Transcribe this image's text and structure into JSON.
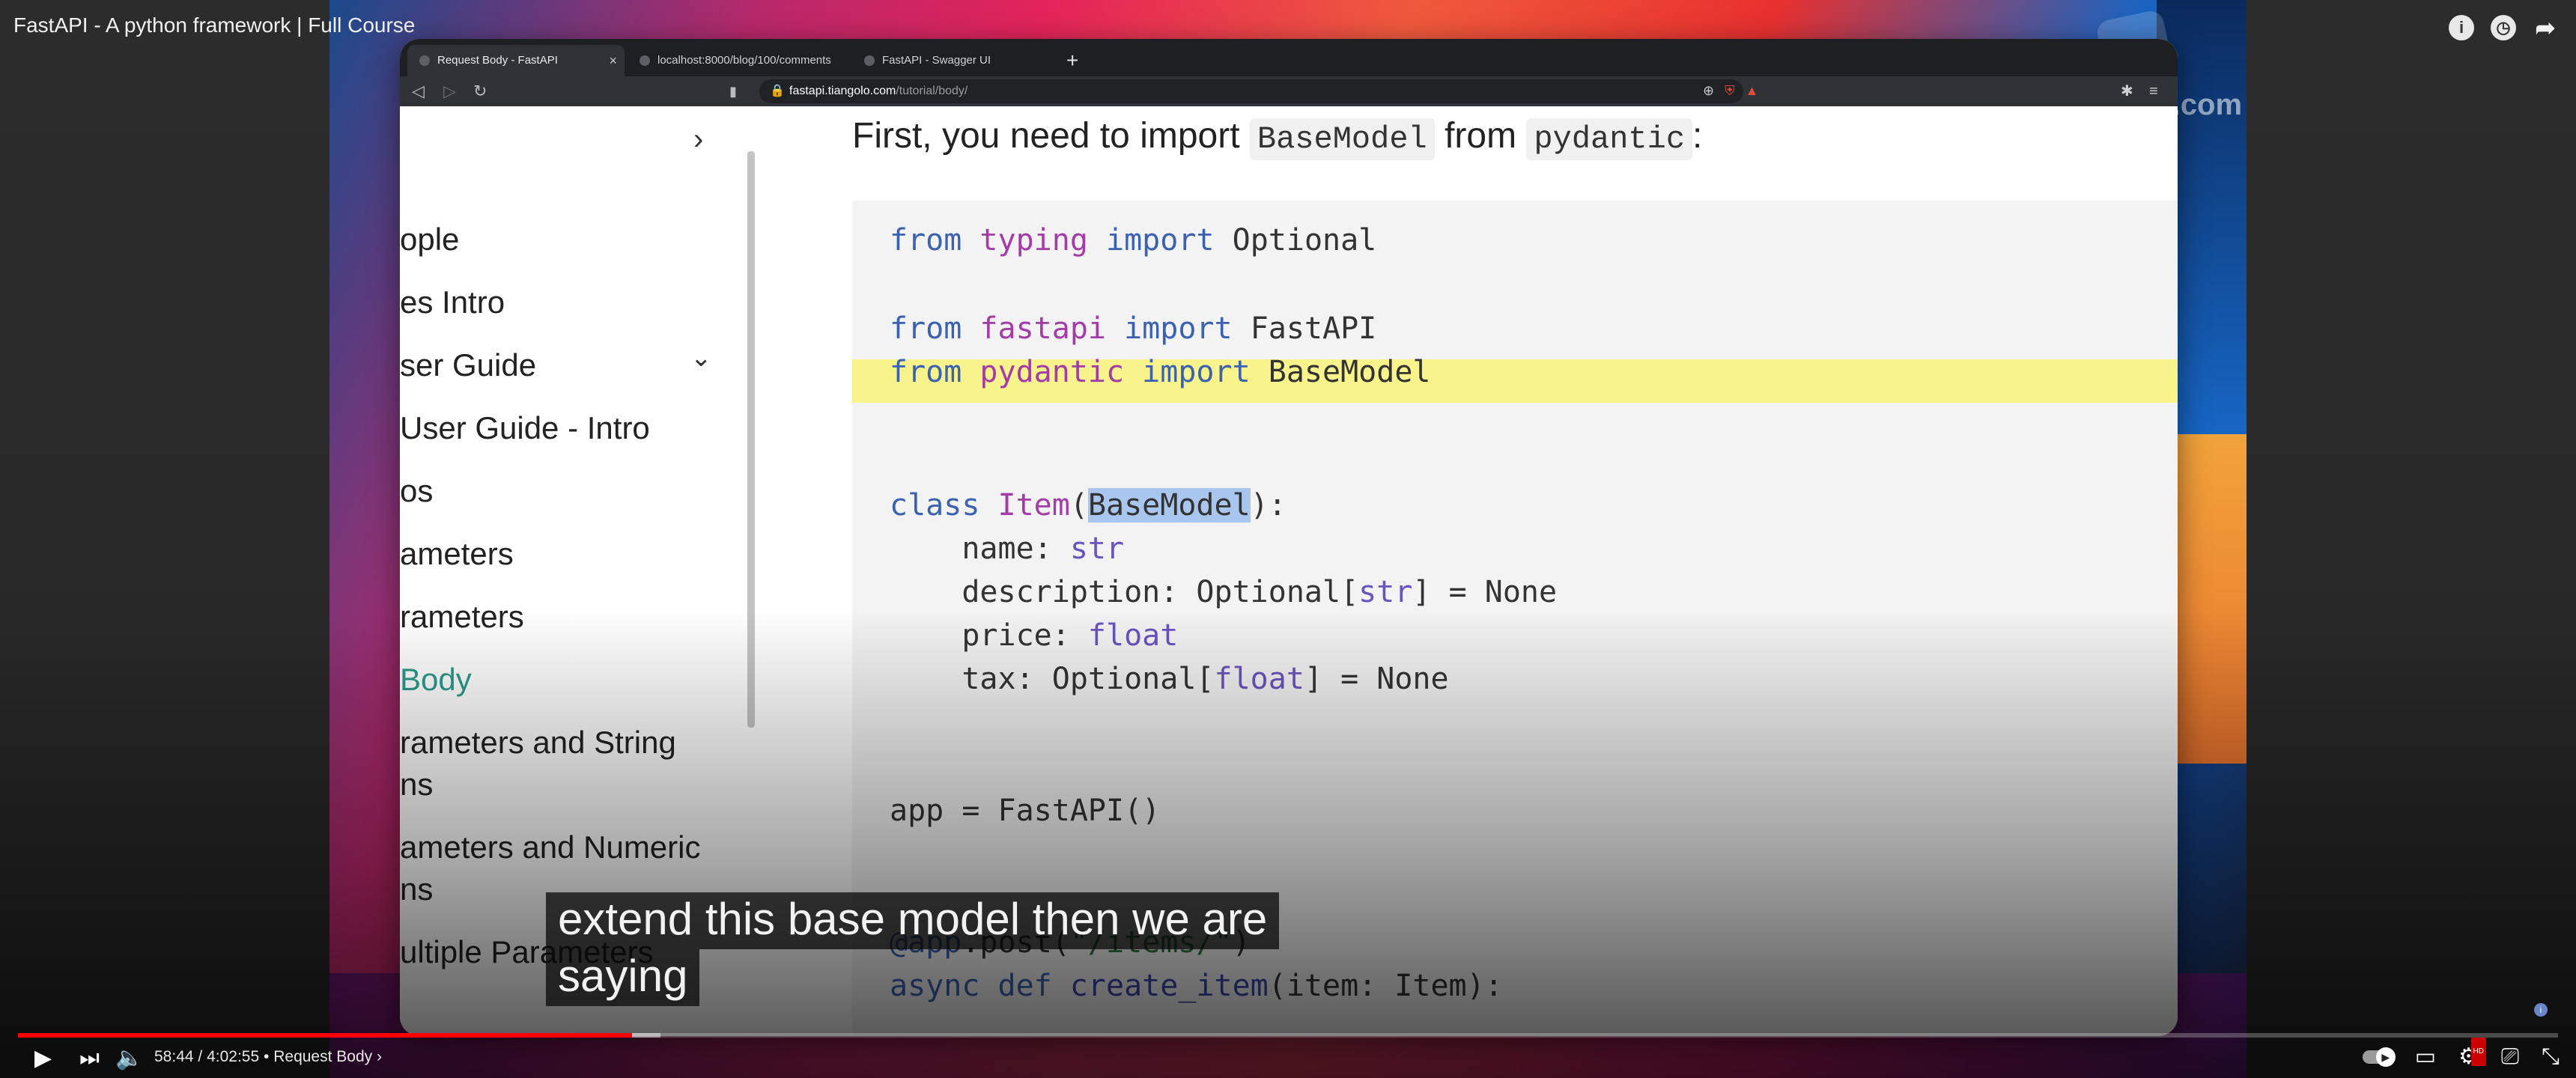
{
  "player": {
    "title": "FastAPI - A python framework | Full Course",
    "top_icons": [
      "info-icon",
      "clock-icon",
      "share-icon"
    ],
    "time_current": "58:44",
    "time_total": "4:02:55",
    "time_separator": "/",
    "chapter": "Request Body",
    "chapter_arrow": "›",
    "bullet": "•",
    "progress_fraction": 0.2418,
    "buffer_fraction": 0.253,
    "accent": "#ff0000",
    "hd_tag": "HD"
  },
  "caption": {
    "line1": "extend this base model then we are",
    "line2": "saying"
  },
  "watermark": {
    "text": "bitfumes.com"
  },
  "browser": {
    "tabs": [
      {
        "label": "Request Body - FastAPI",
        "active": true,
        "close": "×"
      },
      {
        "label": "localhost:8000/blog/100/comments",
        "active": false
      },
      {
        "label": "FastAPI - Swagger UI",
        "active": false
      }
    ],
    "new_tab": "+",
    "url_host": "fastapi.tiangolo.com",
    "url_path": "/tutorial/body/"
  },
  "sidebar": {
    "items": [
      {
        "label": "ople"
      },
      {
        "label": "es Intro"
      },
      {
        "label": "ser Guide"
      },
      {
        "label": " User Guide - Intro"
      },
      {
        "label": "os"
      },
      {
        "label": "ameters"
      },
      {
        "label": "rameters"
      },
      {
        "label": "Body",
        "active": true
      },
      {
        "label": "rameters and String"
      },
      {
        "label": "ns"
      },
      {
        "label": "ameters and Numeric"
      },
      {
        "label": "ns"
      },
      {
        "label": "ultiple Parameters"
      }
    ]
  },
  "doc": {
    "lead_before": "First, you need to import ",
    "lead_code1": "BaseModel",
    "lead_mid": " from ",
    "lead_code2": "pydantic",
    "lead_after": ":"
  },
  "code": {
    "l1": {
      "kw1": "from",
      "mod": "typing",
      "kw2": "import",
      "name": "Optional"
    },
    "l2": {
      "kw1": "from",
      "mod": "fastapi",
      "kw2": "import",
      "name": "FastAPI"
    },
    "l3": {
      "kw1": "from",
      "mod": "pydantic",
      "kw2": "import",
      "name": "BaseModel"
    },
    "l4": {
      "kw": "class",
      "cls": "Item",
      "open": "(",
      "base": "BaseModel",
      "close": "):"
    },
    "l5": {
      "field": "    name",
      "colon": ": ",
      "type": "str"
    },
    "l6": {
      "field": "    description",
      "colon": ": ",
      "pre": "Optional[",
      "type": "str",
      "post": "] = None"
    },
    "l7": {
      "field": "    price",
      "colon": ": ",
      "type": "float"
    },
    "l8": {
      "field": "    tax",
      "colon": ": ",
      "pre": "Optional[",
      "type": "float",
      "post": "] = None"
    },
    "l9": {
      "text": "app = FastAPI()"
    },
    "l10": {
      "deco": "@app",
      "rest": ".post(",
      "str": "\"/items/\"",
      "close": ")"
    },
    "l11": {
      "kw": "async def ",
      "fn": "create_item",
      "rest": "(item: Item):"
    }
  }
}
